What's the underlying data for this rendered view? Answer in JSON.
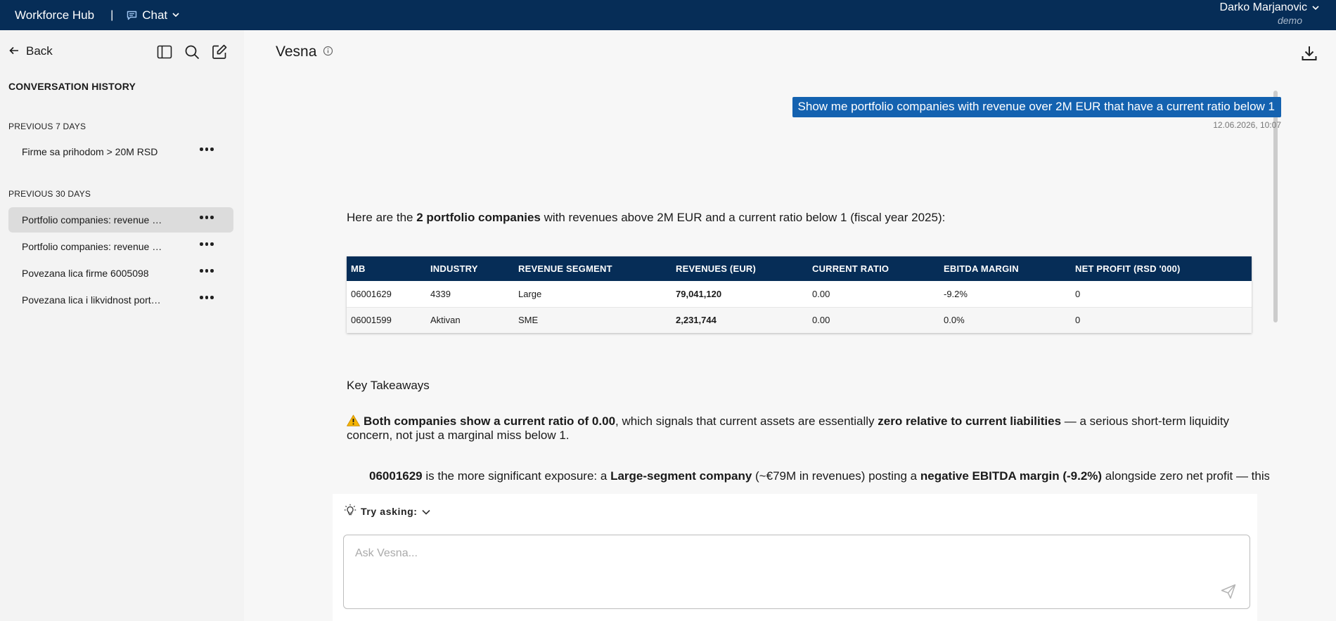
{
  "header": {
    "brand": "Workforce Hub",
    "separator": "|",
    "module": "Chat",
    "user_name": "Darko Marjanovic",
    "user_role": "demo"
  },
  "sidebar": {
    "back_label": "Back",
    "history_title": "CONVERSATION HISTORY",
    "groups": [
      {
        "label": "PREVIOUS 7 DAYS",
        "items": [
          {
            "label": "Firme sa prihodom > 20M RSD",
            "active": false
          }
        ]
      },
      {
        "label": "PREVIOUS 30 DAYS",
        "items": [
          {
            "label": "Portfolio companies: revenue …",
            "active": true
          },
          {
            "label": "Portfolio companies: revenue …",
            "active": false
          },
          {
            "label": "Povezana lica firme 6005098",
            "active": false
          },
          {
            "label": "Povezana lica i likvidnost port…",
            "active": false
          }
        ]
      }
    ]
  },
  "main": {
    "title": "Vesna",
    "user_message": "Show me portfolio companies with revenue over 2M EUR that have a current ratio below 1",
    "timestamp": "12.06.2026, 10:07",
    "answer": {
      "intro_pre": "Here are the ",
      "intro_bold": "2 portfolio companies",
      "intro_post": " with revenues above 2M EUR and a current ratio below 1 (fiscal year 2025):"
    },
    "table": {
      "headers": [
        "MB",
        "INDUSTRY",
        "REVENUE SEGMENT",
        "REVENUES (EUR)",
        "CURRENT RATIO",
        "EBITDA MARGIN",
        "NET PROFIT (RSD '000)"
      ],
      "rows": [
        [
          "06001629",
          "4339",
          "Large",
          "79,041,120",
          "0.00",
          "-9.2%",
          "0"
        ],
        [
          "06001599",
          "Aktivan",
          "SME",
          "2,231,744",
          "0.00",
          "0.0%",
          "0"
        ]
      ]
    },
    "takeaways": {
      "title": "Key Takeaways",
      "p1_bold1": "Both companies show a current ratio of 0.00",
      "p1_text1": ", which signals that current assets are essentially ",
      "p1_bold2": "zero relative to current liabilities",
      "p1_text2": " — a serious short-term liquidity concern, not just a marginal miss below 1.",
      "b1_bold1": "06001629",
      "b1_text1": " is the more significant exposure: a ",
      "b1_bold2": "Large-segment company",
      "b1_text2": " (~€79M in revenues) posting a ",
      "b1_bold3": "negative EBITDA margin (-9.2%)",
      "b1_text3": " alongside zero net profit — this"
    },
    "composer": {
      "try_label": "Try asking:",
      "placeholder": "Ask Vesna..."
    }
  },
  "colors": {
    "topbar": "#062d57",
    "accent": "#1462b0",
    "active_item": "#dcdcdc"
  }
}
